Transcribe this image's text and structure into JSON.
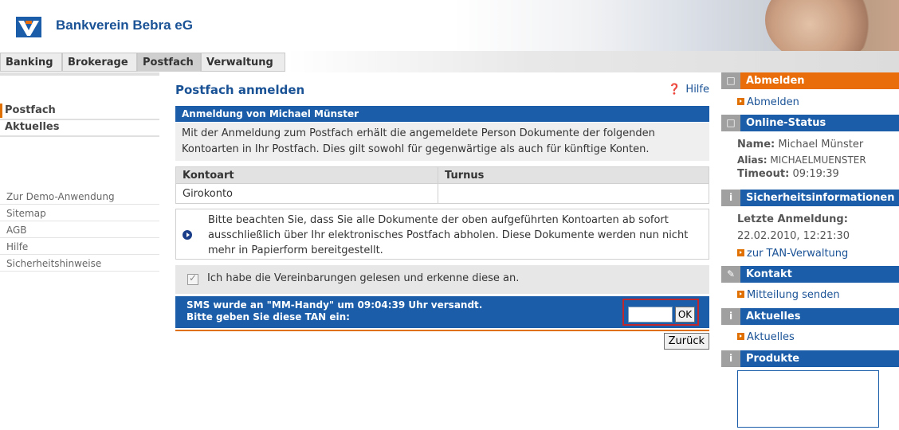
{
  "header": {
    "bank_name": "Bankverein Bebra eG"
  },
  "nav": {
    "tabs": [
      "Banking",
      "Brokerage",
      "Postfach",
      "Verwaltung"
    ]
  },
  "left": {
    "items": [
      "Postfach",
      "Aktuelles"
    ],
    "links": [
      "Zur Demo-Anwendung",
      "Sitemap",
      "AGB",
      "Hilfe",
      "Sicherheitshinweise"
    ]
  },
  "main": {
    "title": "Postfach anmelden",
    "help": "Hilfe",
    "box_title": "Anmeldung von Michael Münster",
    "info": "Mit der Anmeldung zum Postfach erhält die angemeldete Person Dokumente der folgenden Kontoarten in Ihr Postfach. Dies gilt sowohl für gegenwärtige als auch für künftige Konten.",
    "table": {
      "headers": [
        "Kontoart",
        "Turnus"
      ],
      "rows": [
        [
          "Girokonto",
          ""
        ]
      ]
    },
    "notice": "Bitte beachten Sie, dass Sie alle Dokumente der oben aufgeführten Kontoarten ab sofort ausschließlich über Ihr elektronisches Postfach abholen. Diese Dokumente werden nun nicht mehr in Papierform bereitgestellt.",
    "consent": "Ich habe die Vereinbarungen gelesen und erkenne diese an.",
    "sms_line1": "SMS wurde an \"MM-Handy\" um 09:04:39 Uhr versandt.",
    "sms_line2": "Bitte geben Sie diese TAN ein:",
    "tan_value": "",
    "ok": "OK",
    "back": "Zurück"
  },
  "right": {
    "abmelden_title": "Abmelden",
    "abmelden_link": "Abmelden",
    "status_title": "Online-Status",
    "name_label": "Name:",
    "name_value": "Michael Münster",
    "alias_label": "Alias:",
    "alias_value": "MICHAELMUENSTER",
    "timeout_label": "Timeout:",
    "timeout_value": "09:19:39",
    "sec_title": "Sicherheitsinformationen",
    "last_login_label": "Letzte Anmeldung:",
    "last_login_value": "22.02.2010, 12:21:30",
    "tan_link": "zur TAN-Verwaltung",
    "contact_title": "Kontakt",
    "contact_link": "Mitteilung senden",
    "news_title": "Aktuelles",
    "news_link": "Aktuelles",
    "products_title": "Produkte"
  },
  "colors": {
    "brand_blue": "#1b5da8",
    "accent_orange": "#e96e0b",
    "highlight_red": "#c0272d"
  }
}
